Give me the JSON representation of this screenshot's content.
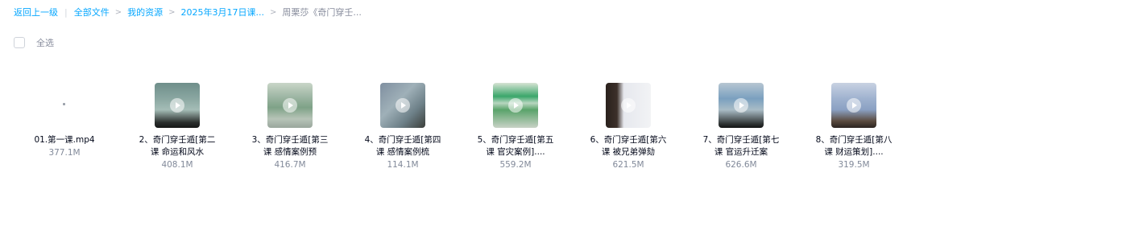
{
  "breadcrumb": {
    "back": "返回上一级",
    "all_files": "全部文件",
    "my_resources": "我的资源",
    "folder": "2025年3月17日课...",
    "current": "周栗莎《奇门穿壬..."
  },
  "select_all": {
    "label": "全选"
  },
  "files": [
    {
      "name": "01.第一课.mp4",
      "size": "377.1M",
      "thumb": "none"
    },
    {
      "name": "2、奇门穿壬遁[第二课 命运和风水",
      "size": "408.1M",
      "thumb": "video"
    },
    {
      "name": "3、奇门穿壬遁[第三课 感情案例预",
      "size": "416.7M",
      "thumb": "video"
    },
    {
      "name": "4、奇门穿壬遁[第四课 感情案例梳",
      "size": "114.1M",
      "thumb": "video"
    },
    {
      "name": "5、奇门穿壬遁[第五课 官灾案例]....",
      "size": "559.2M",
      "thumb": "video"
    },
    {
      "name": "6、奇门穿壬遁[第六课 被兄弟弹劾",
      "size": "621.5M",
      "thumb": "video"
    },
    {
      "name": "7、奇门穿壬遁[第七课 官运升迁案",
      "size": "626.6M",
      "thumb": "video"
    },
    {
      "name": "8、奇门穿壬遁[第八课 财运策划]....",
      "size": "319.5M",
      "thumb": "video"
    }
  ],
  "icons": {
    "play": "play-icon",
    "chevron": "chevron-right-icon"
  }
}
